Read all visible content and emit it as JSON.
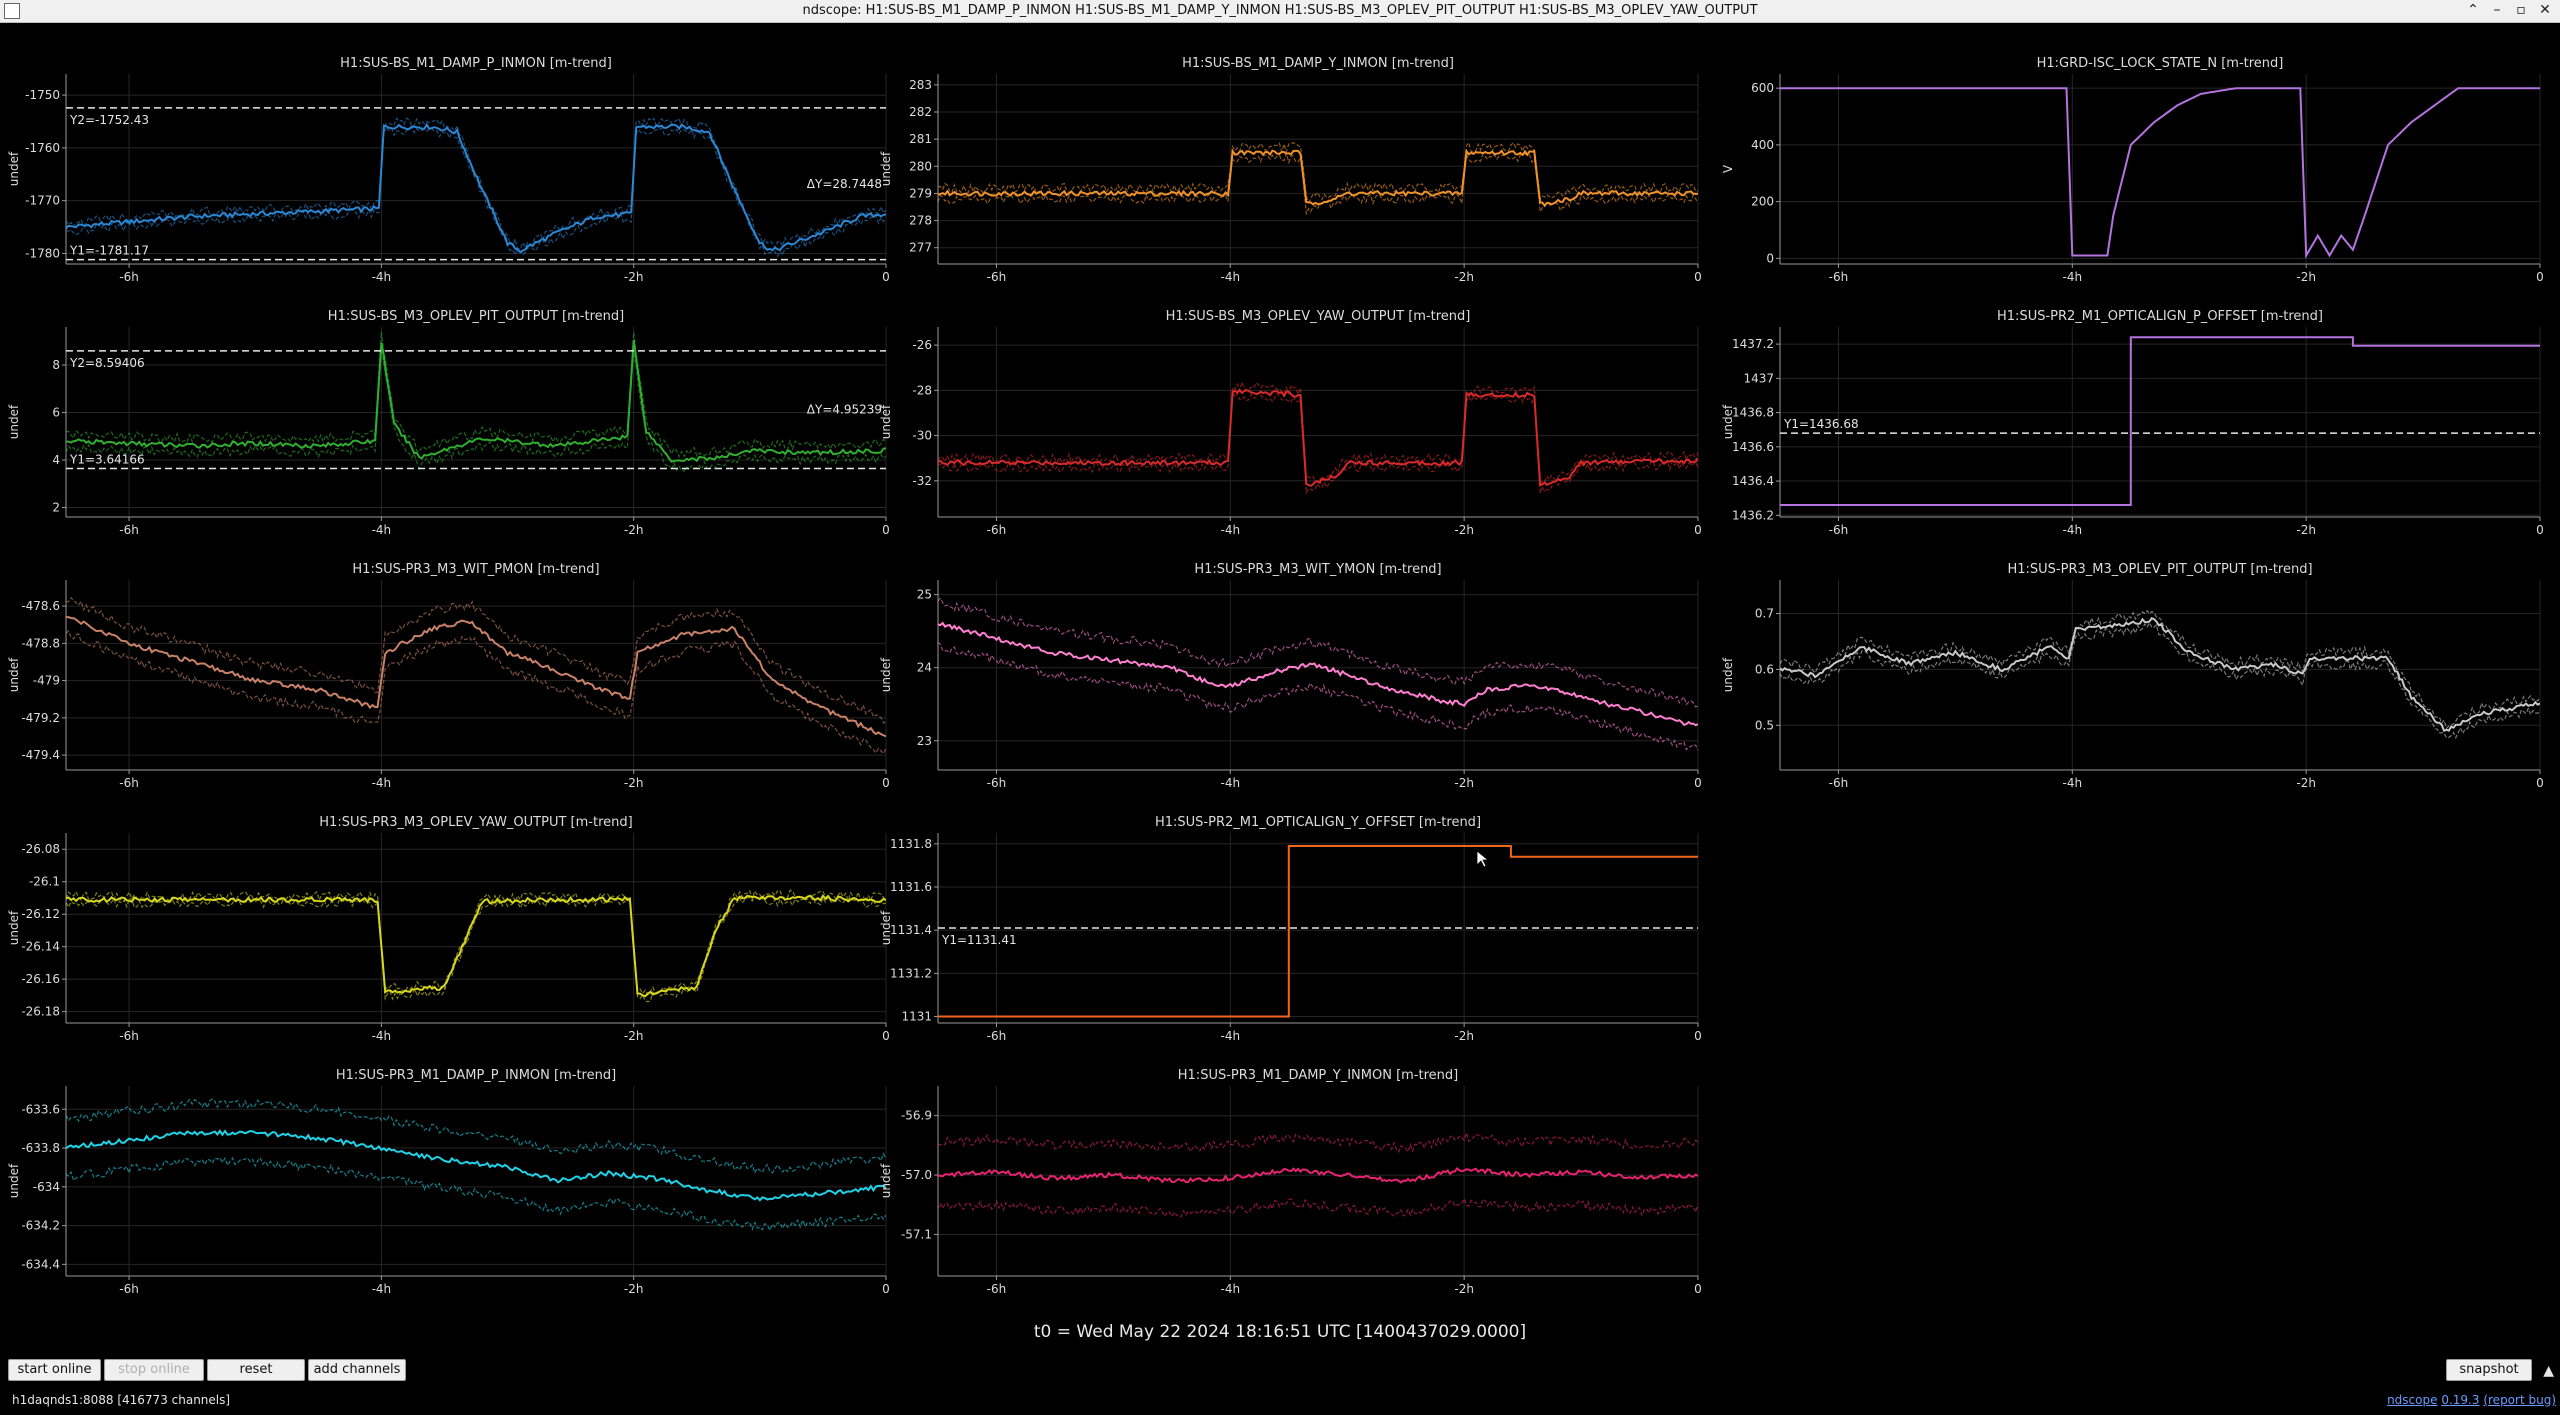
{
  "window": {
    "title": "ndscope: H1:SUS-BS_M1_DAMP_P_INMON H1:SUS-BS_M1_DAMP_Y_INMON H1:SUS-BS_M3_OPLEV_PIT_OUTPUT H1:SUS-BS_M3_OPLEV_YAW_OUTPUT"
  },
  "chart_data": [
    {
      "type": "line",
      "title": "H1:SUS-BS_M1_DAMP_P_INMON [m-trend]",
      "ylabel": "undef",
      "color": "#2b86d3",
      "ylim": [
        -1782,
        -1746
      ],
      "yticks": [
        -1780,
        -1770,
        -1760,
        -1750
      ],
      "ytick_labels": [
        "-1780",
        "-1770",
        "-1760",
        "-1750"
      ],
      "xlim": [
        -6.5,
        0
      ],
      "xticks": [
        -6,
        -4,
        -2,
        0
      ],
      "xtick_labels": [
        "-6h",
        "-4h",
        "-2h",
        "0"
      ],
      "band": 0.8,
      "x": [
        -6.5,
        -6,
        -5.5,
        -5,
        -4.5,
        -4.02,
        -3.98,
        -3.6,
        -3.4,
        -3.2,
        -3.0,
        -2.9,
        -2.6,
        -2.3,
        -2.02,
        -1.98,
        -1.6,
        -1.4,
        -1.2,
        -1.0,
        -0.9,
        -0.5,
        -0.2,
        0
      ],
      "y": [
        -1775,
        -1774,
        -1773,
        -1772.5,
        -1772,
        -1771.5,
        -1756,
        -1756,
        -1757,
        -1768,
        -1778,
        -1779.5,
        -1776,
        -1773,
        -1772.5,
        -1756,
        -1756,
        -1757,
        -1768,
        -1778,
        -1779.5,
        -1776,
        -1773,
        -1772.5
      ],
      "cursors": [
        {
          "orient": "h",
          "value": -1752.43,
          "label": "Y2=-1752.43"
        },
        {
          "orient": "h",
          "value": -1781.17,
          "label": "Y1=-1781.17"
        }
      ],
      "delta_label": "ΔY=28.7448"
    },
    {
      "type": "line",
      "title": "H1:SUS-BS_M1_DAMP_Y_INMON [m-trend]",
      "ylabel": "undef",
      "color": "#f0922a",
      "ylim": [
        276.4,
        283.4
      ],
      "yticks": [
        277,
        278,
        279,
        280,
        281,
        282,
        283
      ],
      "ytick_labels": [
        "277",
        "278",
        "279",
        "280",
        "281",
        "282",
        "283"
      ],
      "xlim": [
        -6.5,
        0
      ],
      "xticks": [
        -6,
        -4,
        -2,
        0
      ],
      "xtick_labels": [
        "-6h",
        "-4h",
        "-2h",
        "0"
      ],
      "band": 0.2,
      "x": [
        -6.5,
        -4.02,
        -3.98,
        -3.4,
        -3.35,
        -3.1,
        -3.0,
        -2.02,
        -1.98,
        -1.4,
        -1.35,
        -1.1,
        -1.0,
        0
      ],
      "y": [
        279,
        279,
        280.5,
        280.5,
        278.6,
        278.8,
        279,
        279,
        280.5,
        280.5,
        278.6,
        278.8,
        279,
        279
      ]
    },
    {
      "type": "line",
      "title": "H1:GRD-ISC_LOCK_STATE_N [m-trend]",
      "ylabel": "V",
      "color": "#b473e0",
      "ylim": [
        -20,
        650
      ],
      "yticks": [
        0,
        200,
        400,
        600
      ],
      "ytick_labels": [
        "0",
        "200",
        "400",
        "600"
      ],
      "xlim": [
        -6.5,
        0
      ],
      "xticks": [
        -6,
        -4,
        -2,
        0
      ],
      "xtick_labels": [
        "-6h",
        "-4h",
        "-2h",
        "0"
      ],
      "band": 0,
      "x": [
        -6.5,
        -4.05,
        -4.0,
        -3.7,
        -3.65,
        -3.5,
        -3.3,
        -3.1,
        -2.9,
        -2.6,
        -2.05,
        -2.0,
        -1.9,
        -1.8,
        -1.7,
        -1.6,
        -1.5,
        -1.3,
        -1.1,
        -0.9,
        -0.7,
        0
      ],
      "y": [
        600,
        600,
        10,
        10,
        150,
        400,
        480,
        540,
        580,
        600,
        600,
        10,
        80,
        10,
        80,
        30,
        150,
        400,
        480,
        540,
        600,
        600
      ]
    },
    {
      "type": "line",
      "title": "H1:SUS-BS_M3_OPLEV_PIT_OUTPUT [m-trend]",
      "ylabel": "undef",
      "color": "#2fae2f",
      "ylim": [
        1.6,
        9.6
      ],
      "yticks": [
        2,
        4,
        6,
        8
      ],
      "ytick_labels": [
        "2",
        "4",
        "6",
        "8"
      ],
      "xlim": [
        -6.5,
        0
      ],
      "xticks": [
        -6,
        -4,
        -2,
        0
      ],
      "xtick_labels": [
        "-6h",
        "-4h",
        "-2h",
        "0"
      ],
      "band": 0.3,
      "x": [
        -6.5,
        -6,
        -5.5,
        -5,
        -4.5,
        -4.05,
        -4.0,
        -3.9,
        -3.7,
        -3.4,
        -3.2,
        -2.6,
        -2.05,
        -2.0,
        -1.9,
        -1.7,
        -1.3,
        -1.1,
        -0.6,
        0
      ],
      "y": [
        4.8,
        4.7,
        4.6,
        4.7,
        4.6,
        4.8,
        9,
        5.5,
        4.1,
        4.6,
        4.9,
        4.6,
        5.0,
        9,
        5.2,
        4.0,
        4.1,
        4.4,
        4.3,
        4.4
      ],
      "cursors": [
        {
          "orient": "h",
          "value": 8.59406,
          "label": "Y2=8.59406"
        },
        {
          "orient": "h",
          "value": 3.64166,
          "label": "Y1=3.64166"
        }
      ],
      "delta_label": "ΔY=4.95239"
    },
    {
      "type": "line",
      "title": "H1:SUS-BS_M3_OPLEV_YAW_OUTPUT [m-trend]",
      "ylabel": "undef",
      "color": "#d82a2a",
      "ylim": [
        -33.6,
        -25.2
      ],
      "yticks": [
        -32,
        -30,
        -28,
        -26
      ],
      "ytick_labels": [
        "-32",
        "-30",
        "-28",
        "-26"
      ],
      "xlim": [
        -6.5,
        0
      ],
      "xticks": [
        -6,
        -4,
        -2,
        0
      ],
      "xtick_labels": [
        "-6h",
        "-4h",
        "-2h",
        "0"
      ],
      "band": 0.2,
      "x": [
        -6.5,
        -4.02,
        -3.98,
        -3.4,
        -3.35,
        -3.1,
        -3.0,
        -2.02,
        -1.98,
        -1.4,
        -1.35,
        -1.1,
        -1.0,
        0
      ],
      "y": [
        -31.2,
        -31.2,
        -28,
        -28.2,
        -32.2,
        -31.8,
        -31.2,
        -31.2,
        -28.2,
        -28.2,
        -32.2,
        -31.8,
        -31.2,
        -31.1
      ]
    },
    {
      "type": "line",
      "title": "H1:SUS-PR2_M1_OPTICALIGN_P_OFFSET [m-trend]",
      "ylabel": "undef",
      "color": "#b473e0",
      "ylim": [
        1436.19,
        1437.3
      ],
      "yticks": [
        1436.2,
        1436.4,
        1436.6,
        1436.8,
        1437,
        1437.2
      ],
      "ytick_labels": [
        "1436.2",
        "1436.4",
        "1436.6",
        "1436.8",
        "1437",
        "1437.2"
      ],
      "xlim": [
        -6.5,
        0
      ],
      "xticks": [
        -6,
        -4,
        -2,
        0
      ],
      "xtick_labels": [
        "-6h",
        "-4h",
        "-2h",
        "0"
      ],
      "band": 0,
      "x": [
        -6.5,
        -3.5,
        -3.5,
        -1.6,
        -1.6,
        0
      ],
      "y": [
        1436.26,
        1436.26,
        1437.24,
        1437.24,
        1437.19,
        1437.19
      ],
      "cursors": [
        {
          "orient": "h",
          "value": 1436.68,
          "label": "Y1=1436.68"
        }
      ]
    },
    {
      "type": "line",
      "title": "H1:SUS-PR3_M3_WIT_PMON [m-trend]",
      "ylabel": "undef",
      "color": "#c98268",
      "ylim": [
        -479.48,
        -478.46
      ],
      "yticks": [
        -479.4,
        -479.2,
        -479,
        -478.8,
        -478.6
      ],
      "ytick_labels": [
        "-479.4",
        "-479.2",
        "-479",
        "-478.8",
        "-478.6"
      ],
      "xlim": [
        -6.5,
        0
      ],
      "xticks": [
        -6,
        -4,
        -2,
        0
      ],
      "xtick_labels": [
        "-6h",
        "-4h",
        "-2h",
        "0"
      ],
      "band": 0.09,
      "x": [
        -6.5,
        -6,
        -5.5,
        -5,
        -4.5,
        -4.03,
        -3.97,
        -3.6,
        -3.3,
        -3.0,
        -2.6,
        -2.25,
        -2.03,
        -1.97,
        -1.6,
        -1.2,
        -0.9,
        -0.5,
        0
      ],
      "y": [
        -478.65,
        -478.8,
        -478.9,
        -479.0,
        -479.05,
        -479.15,
        -478.85,
        -478.72,
        -478.68,
        -478.85,
        -478.95,
        -479.05,
        -479.1,
        -478.85,
        -478.75,
        -478.72,
        -479.0,
        -479.15,
        -479.3
      ]
    },
    {
      "type": "line",
      "title": "H1:SUS-PR3_M3_WIT_YMON [m-trend]",
      "ylabel": "undef",
      "color": "#ff7fd0",
      "ylim": [
        22.6,
        25.2
      ],
      "yticks": [
        23,
        24,
        25
      ],
      "ytick_labels": [
        "23",
        "24",
        "25"
      ],
      "xlim": [
        -6.5,
        0
      ],
      "xticks": [
        -6,
        -4,
        -2,
        0
      ],
      "xtick_labels": [
        "-6h",
        "-4h",
        "-2h",
        "0"
      ],
      "band": 0.3,
      "x": [
        -6.5,
        -6,
        -5.5,
        -5,
        -4.5,
        -4.2,
        -4.0,
        -3.6,
        -3.3,
        -3.0,
        -2.6,
        -2.2,
        -2.0,
        -1.8,
        -1.5,
        -1.2,
        -0.9,
        -0.5,
        0
      ],
      "y": [
        24.6,
        24.4,
        24.2,
        24.1,
        24.0,
        23.8,
        23.75,
        23.95,
        24.05,
        23.9,
        23.7,
        23.55,
        23.5,
        23.7,
        23.75,
        23.7,
        23.55,
        23.4,
        23.2
      ]
    },
    {
      "type": "line",
      "title": "H1:SUS-PR3_M3_OPLEV_PIT_OUTPUT [m-trend]",
      "ylabel": "undef",
      "color": "#c8c8c8",
      "ylim": [
        0.42,
        0.76
      ],
      "yticks": [
        0.5,
        0.6,
        0.7
      ],
      "ytick_labels": [
        "0.5",
        "0.6",
        "0.7"
      ],
      "xlim": [
        -6.5,
        0
      ],
      "xticks": [
        -6,
        -4,
        -2,
        0
      ],
      "xtick_labels": [
        "-6h",
        "-4h",
        "-2h",
        "0"
      ],
      "band": 0.012,
      "x": [
        -6.5,
        -6.2,
        -5.8,
        -5.4,
        -5.0,
        -4.6,
        -4.2,
        -4.03,
        -3.97,
        -3.6,
        -3.3,
        -3.0,
        -2.6,
        -2.3,
        -2.03,
        -1.97,
        -1.6,
        -1.3,
        -1.1,
        -0.8,
        -0.5,
        0
      ],
      "y": [
        0.6,
        0.59,
        0.64,
        0.61,
        0.63,
        0.6,
        0.64,
        0.62,
        0.67,
        0.68,
        0.69,
        0.63,
        0.6,
        0.61,
        0.59,
        0.62,
        0.62,
        0.62,
        0.55,
        0.49,
        0.52,
        0.54
      ]
    },
    {
      "type": "line",
      "title": "H1:SUS-PR3_M3_OPLEV_YAW_OUTPUT [m-trend]",
      "ylabel": "undef",
      "color": "#d6d61e",
      "ylim": [
        -26.187,
        -26.07
      ],
      "yticks": [
        -26.18,
        -26.16,
        -26.14,
        -26.12,
        -26.1,
        -26.08
      ],
      "ytick_labels": [
        "-26.18",
        "-26.16",
        "-26.14",
        "-26.12",
        "-26.1",
        "-26.08"
      ],
      "xlim": [
        -6.5,
        0
      ],
      "xticks": [
        -6,
        -4,
        -2,
        0
      ],
      "xtick_labels": [
        "-6h",
        "-4h",
        "-2h",
        "0"
      ],
      "band": 0.002,
      "x": [
        -6.5,
        -4.03,
        -3.97,
        -3.5,
        -3.3,
        -3.2,
        -2.5,
        -2.03,
        -1.97,
        -1.5,
        -1.35,
        -1.2,
        -0.5,
        0
      ],
      "y": [
        -26.111,
        -26.111,
        -26.168,
        -26.165,
        -26.13,
        -26.112,
        -26.111,
        -26.111,
        -26.17,
        -26.165,
        -26.13,
        -26.11,
        -26.11,
        -26.112
      ]
    },
    {
      "type": "line",
      "title": "H1:SUS-PR2_M1_OPTICALIGN_Y_OFFSET [m-trend]",
      "ylabel": "undef",
      "color": "#f0661a",
      "ylim": [
        1130.97,
        1131.85
      ],
      "yticks": [
        1131,
        1131.2,
        1131.4,
        1131.6,
        1131.8
      ],
      "ytick_labels": [
        "1131",
        "1131.2",
        "1131.4",
        "1131.6",
        "1131.8"
      ],
      "xlim": [
        -6.5,
        0
      ],
      "xticks": [
        -6,
        -4,
        -2,
        0
      ],
      "xtick_labels": [
        "-6h",
        "-4h",
        "-2h",
        "0"
      ],
      "band": 0,
      "x": [
        -6.5,
        -3.5,
        -3.5,
        -1.6,
        -1.6,
        0
      ],
      "y": [
        1131.0,
        1131.0,
        1131.79,
        1131.79,
        1131.74,
        1131.74
      ],
      "cursors": [
        {
          "orient": "h",
          "value": 1131.41,
          "label": "Y1=1131.41"
        }
      ]
    },
    {
      "type": "line",
      "title": "H1:SUS-PR3_M1_DAMP_P_INMON [m-trend]",
      "ylabel": "undef",
      "color": "#1fd2e6",
      "ylim": [
        -634.46,
        -633.48
      ],
      "yticks": [
        -634.4,
        -634.2,
        -634,
        -633.8,
        -633.6
      ],
      "ytick_labels": [
        "-634.4",
        "-634.2",
        "-634",
        "-633.8",
        "-633.6"
      ],
      "xlim": [
        -6.5,
        0
      ],
      "xticks": [
        -6,
        -4,
        -2,
        0
      ],
      "xtick_labels": [
        "-6h",
        "-4h",
        "-2h",
        "0"
      ],
      "band": 0.15,
      "x": [
        -6.5,
        -6,
        -5.5,
        -5,
        -4.5,
        -4.0,
        -3.6,
        -3.0,
        -2.6,
        -2.2,
        -1.8,
        -1.4,
        -1.0,
        -0.6,
        0
      ],
      "y": [
        -633.8,
        -633.76,
        -633.72,
        -633.72,
        -633.75,
        -633.8,
        -633.85,
        -633.9,
        -633.97,
        -633.93,
        -633.96,
        -634.02,
        -634.06,
        -634.04,
        -634.0
      ]
    },
    {
      "type": "line",
      "title": "H1:SUS-PR3_M1_DAMP_Y_INMON [m-trend]",
      "ylabel": "undef",
      "color": "#e6236e",
      "ylim": [
        -57.17,
        -56.85
      ],
      "yticks": [
        -57.1,
        -57.0,
        -56.9
      ],
      "ytick_labels": [
        "-57.1",
        "-57.0",
        "-56.9"
      ],
      "xlim": [
        -6.5,
        0
      ],
      "xticks": [
        -6,
        -4,
        -2,
        0
      ],
      "xtick_labels": [
        "-6h",
        "-4h",
        "-2h",
        "0"
      ],
      "band": 0.055,
      "x": [
        -6.5,
        -6,
        -5.5,
        -5,
        -4.5,
        -4.0,
        -3.5,
        -3.0,
        -2.5,
        -2.0,
        -1.5,
        -1.0,
        -0.5,
        0
      ],
      "y": [
        -57.0,
        -56.995,
        -57.005,
        -57.0,
        -57.01,
        -57.005,
        -56.99,
        -57.0,
        -57.01,
        -56.99,
        -57.0,
        -56.995,
        -57.005,
        -57.0
      ]
    }
  ],
  "footer": {
    "t0": "t0 = Wed May 22 2024 18:16:51 UTC [1400437029.0000]"
  },
  "toolbar": {
    "start_online": "start online",
    "stop_online": "stop online",
    "reset": "reset",
    "add_channels": "add channels",
    "snapshot": "snapshot"
  },
  "status": {
    "server": "h1daqnds1:8088  [416773 channels]",
    "app_name": "ndscope",
    "version": "0.19.3",
    "report_bug": "(report bug)"
  }
}
